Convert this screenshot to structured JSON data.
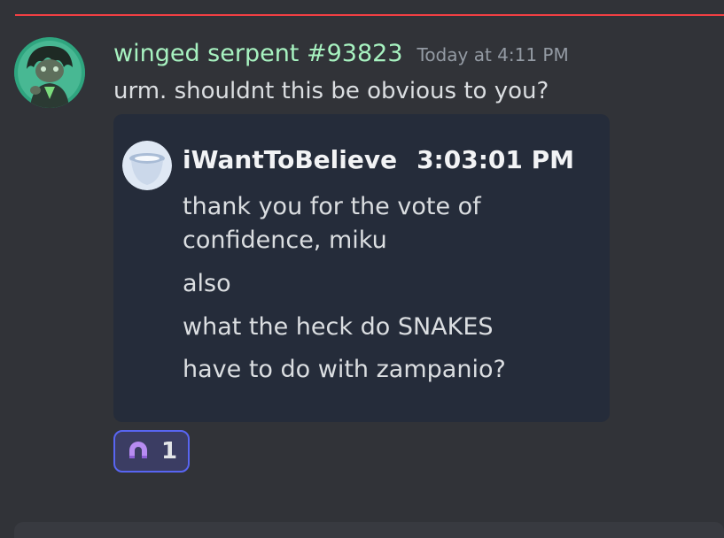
{
  "message": {
    "author": "winged serpent #93823",
    "timestamp": "Today at 4:11 PM",
    "text": "urm. shouldnt this be obvious to you?",
    "avatar_icon": "character-avatar-icon",
    "author_color": "#a7f2c0"
  },
  "embed": {
    "author": "iWantToBelieve",
    "time": "3:03:01 PM",
    "avatar_icon": "fishbowl-avatar-icon",
    "lines": [
      "thank you for the vote of",
      "confidence, miku",
      "also",
      "what the heck do SNAKES",
      "have to do with zampanio?"
    ]
  },
  "reaction": {
    "icon": "horseshoe-magnet-icon",
    "count": "1",
    "accent": "#5865f2"
  },
  "colors": {
    "background": "#313338",
    "new_messages_divider": "#f23f43",
    "embed_background": "#252c3a"
  }
}
